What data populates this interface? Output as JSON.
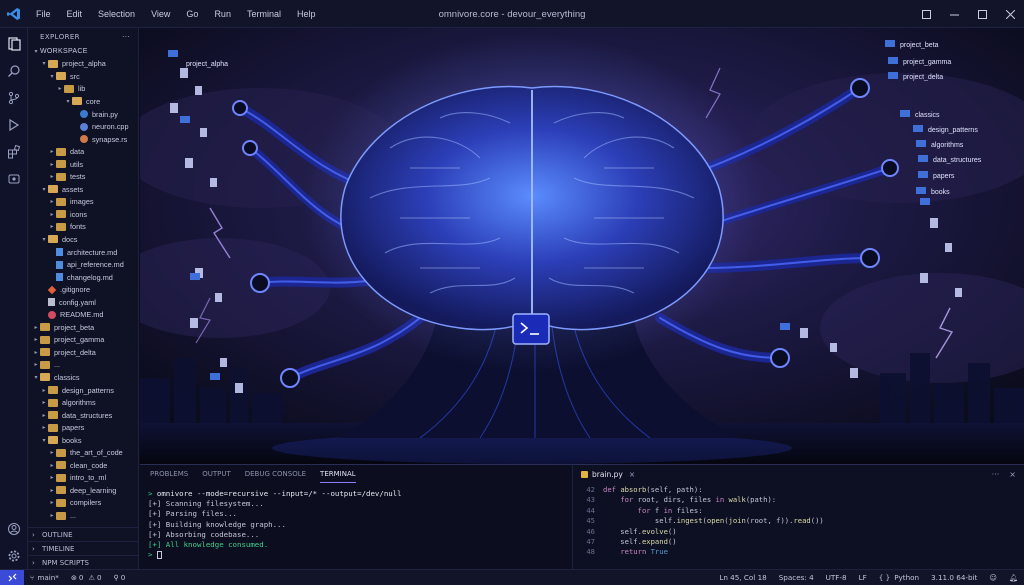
{
  "window": {
    "title": "omnivore.core - devour_everything",
    "menu": [
      "File",
      "Edit",
      "Selection",
      "View",
      "Go",
      "Run",
      "Terminal",
      "Help"
    ]
  },
  "sidebar": {
    "header": "EXPLORER",
    "more": "···",
    "tree": [
      {
        "label": "WORKSPACE",
        "depth": 0,
        "kind": "root",
        "open": true
      },
      {
        "label": "project_alpha",
        "depth": 1,
        "kind": "folder",
        "open": true
      },
      {
        "label": "src",
        "depth": 2,
        "kind": "folder",
        "open": true
      },
      {
        "label": "lib",
        "depth": 3,
        "kind": "folder",
        "open": false
      },
      {
        "label": "core",
        "depth": 4,
        "kind": "folder",
        "open": true
      },
      {
        "label": "brain.py",
        "depth": 5,
        "kind": "py"
      },
      {
        "label": "neuron.cpp",
        "depth": 5,
        "kind": "cpp"
      },
      {
        "label": "synapse.rs",
        "depth": 5,
        "kind": "rs"
      },
      {
        "label": "data",
        "depth": 2,
        "kind": "folder",
        "open": false
      },
      {
        "label": "utils",
        "depth": 2,
        "kind": "folder",
        "open": false
      },
      {
        "label": "tests",
        "depth": 2,
        "kind": "folder",
        "open": false
      },
      {
        "label": "assets",
        "depth": 1,
        "kind": "folder",
        "open": true
      },
      {
        "label": "images",
        "depth": 2,
        "kind": "folder",
        "open": false
      },
      {
        "label": "icons",
        "depth": 2,
        "kind": "folder",
        "open": false
      },
      {
        "label": "fonts",
        "depth": 2,
        "kind": "folder",
        "open": false
      },
      {
        "label": "docs",
        "depth": 1,
        "kind": "folder",
        "open": true
      },
      {
        "label": "architecture.md",
        "depth": 2,
        "kind": "md"
      },
      {
        "label": "api_reference.md",
        "depth": 2,
        "kind": "md"
      },
      {
        "label": "changelog.md",
        "depth": 2,
        "kind": "md"
      },
      {
        "label": ".gitignore",
        "depth": 1,
        "kind": "git"
      },
      {
        "label": "config.yaml",
        "depth": 1,
        "kind": "yml"
      },
      {
        "label": "README.md",
        "depth": 1,
        "kind": "readme"
      },
      {
        "label": "project_beta",
        "depth": 0,
        "kind": "folder",
        "open": false
      },
      {
        "label": "project_gamma",
        "depth": 0,
        "kind": "folder",
        "open": false
      },
      {
        "label": "project_delta",
        "depth": 0,
        "kind": "folder",
        "open": false
      },
      {
        "label": "...",
        "depth": 0,
        "kind": "folder",
        "open": false
      },
      {
        "label": "classics",
        "depth": 0,
        "kind": "folder",
        "open": true
      },
      {
        "label": "design_patterns",
        "depth": 1,
        "kind": "folder",
        "open": false
      },
      {
        "label": "algorithms",
        "depth": 1,
        "kind": "folder",
        "open": false
      },
      {
        "label": "data_structures",
        "depth": 1,
        "kind": "folder",
        "open": false
      },
      {
        "label": "papers",
        "depth": 1,
        "kind": "folder",
        "open": false
      },
      {
        "label": "books",
        "depth": 1,
        "kind": "folder",
        "open": true
      },
      {
        "label": "the_art_of_code",
        "depth": 2,
        "kind": "folder",
        "open": false
      },
      {
        "label": "clean_code",
        "depth": 2,
        "kind": "folder",
        "open": false
      },
      {
        "label": "intro_to_ml",
        "depth": 2,
        "kind": "folder",
        "open": false
      },
      {
        "label": "deep_learning",
        "depth": 2,
        "kind": "folder",
        "open": false
      },
      {
        "label": "compilers",
        "depth": 2,
        "kind": "folder",
        "open": false
      },
      {
        "label": "...",
        "depth": 2,
        "kind": "folder",
        "open": false
      }
    ],
    "sections": [
      "OUTLINE",
      "TIMELINE",
      "NPM SCRIPTS"
    ]
  },
  "hero": {
    "left_labels": [
      "project_alpha"
    ],
    "right_labels": [
      "project_beta",
      "project_gamma",
      "project_delta",
      "classics",
      "design_patterns",
      "algorithms",
      "data_structures",
      "papers",
      "books"
    ]
  },
  "panel": {
    "tabs": [
      "PROBLEMS",
      "OUTPUT",
      "DEBUG CONSOLE",
      "TERMINAL"
    ],
    "active_tab": "TERMINAL",
    "terminal": {
      "command": "omnivore --mode=recursive --input=/* --output=/dev/null",
      "lines": [
        "[+] Scanning filesystem...",
        "[+] Parsing files...",
        "[+] Building knowledge graph...",
        "[+] Absorbing codebase..."
      ],
      "final": "[+] All knowledge consumed.",
      "prompt": ">"
    }
  },
  "editor": {
    "tab": "brain.py",
    "close": "×",
    "ctrls": [
      "···",
      "×"
    ],
    "lines": [
      {
        "n": "42",
        "text": "def absorb(self, path):"
      },
      {
        "n": "43",
        "text": "    for root, dirs, files in walk(path):"
      },
      {
        "n": "44",
        "text": "        for f in files:"
      },
      {
        "n": "45",
        "text": "            self.ingest(open(join(root, f)).read())"
      },
      {
        "n": "46",
        "text": "    self.evolve()"
      },
      {
        "n": "47",
        "text": "    self.expand()"
      },
      {
        "n": "48",
        "text": "    return True"
      }
    ]
  },
  "statusbar": {
    "branch": "main*",
    "errors": "0",
    "warnings": "0",
    "ports": "0",
    "position": "Ln 45, Col 18",
    "spaces": "Spaces: 4",
    "encoding": "UTF-8",
    "eol": "LF",
    "language": "Python",
    "interpreter": "3.11.0 64-bit"
  }
}
